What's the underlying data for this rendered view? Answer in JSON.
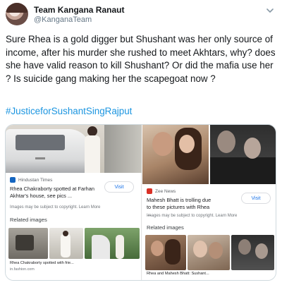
{
  "tweet": {
    "author_name": "Team Kangana Ranaut",
    "author_handle": "@KanganaTeam",
    "body": "Sure Rhea is a gold digger but Shushant was her only source of income, after his murder she rushed to meet Akhtars, why? does she have valid reason to kill Shushant? Or did the mafia use her ? Is suicide gang making her the scapegoat now ?",
    "hashtag": "#JusticeforSushantSingRajput",
    "icons": {
      "avatar": "profile-avatar",
      "menu": "chevron-down-icon"
    }
  },
  "media": {
    "left_result": {
      "source": "Hindustan Times",
      "title": "Rhea Chakraborty spotted at Farhan Akhtar's house, see pics ...",
      "visit_label": "Visit",
      "copyright": "Images may be subject to copyright. Learn More",
      "related_label": "Related images",
      "thumb_caption": "Rhea Chakraborty spotted with frie...",
      "thumb_source": "in.fashion.com"
    },
    "right_result": {
      "source": "Zee News",
      "title": "Mahesh Bhatt is trolling due to these pictures with Rhea ...",
      "visit_label": "Visit",
      "copyright": "Images may be subject to copyright. Learn More",
      "related_label": "Related images",
      "thumb_caption": "Rhea and Mahesh Bhatt: Sushant...",
      "thumb_source": "..."
    },
    "colors": {
      "hashtag": "#1b95e0",
      "visit": "#1a73e8",
      "ht_logo": "#1565c0",
      "zee_logo": "#d93025"
    }
  }
}
